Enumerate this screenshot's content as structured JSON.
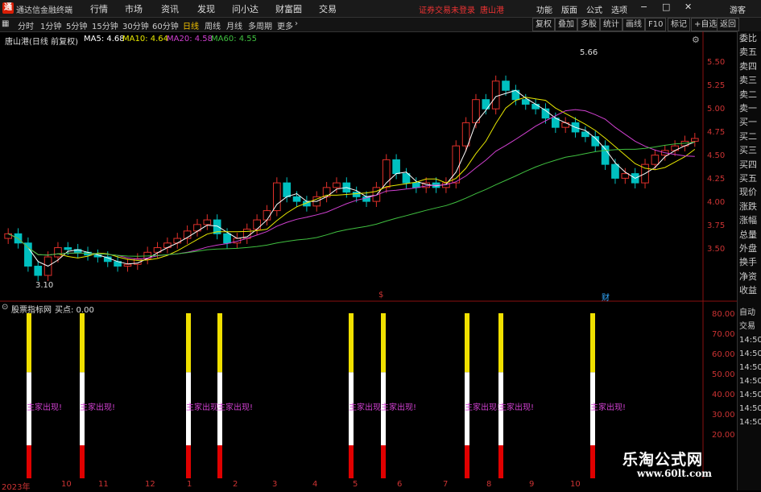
{
  "app": {
    "title": "通达信金融终端",
    "logo": "通"
  },
  "menu": [
    "行情",
    "市场",
    "资讯",
    "发现",
    "问小达",
    "财富圈",
    "交易"
  ],
  "status": {
    "login": "证券交易未登录",
    "stock": "唐山港"
  },
  "menu_right": [
    "功能",
    "版面",
    "公式",
    "选项"
  ],
  "window_buttons": [
    "minimize-icon",
    "maximize-icon",
    "close-icon"
  ],
  "guest": "游客",
  "periods": [
    "分时",
    "1分钟",
    "5分钟",
    "15分钟",
    "30分钟",
    "60分钟",
    "日线",
    "周线",
    "月线",
    "多周期",
    "更多"
  ],
  "period_active": "日线",
  "right_tools": [
    "复权",
    "叠加",
    "多股",
    "统计",
    "画线",
    "F10",
    "标记",
    "+自选",
    "返回"
  ],
  "main_legend": {
    "name": "唐山港(日线 前复权)",
    "ma5": "MA5: 4.68",
    "ma10": "MA10: 4.64",
    "ma20": "MA20: 4.58",
    "ma60": "MA60: 4.55"
  },
  "price_axis": [
    "5.50",
    "5.25",
    "5.00",
    "4.75",
    "4.50",
    "4.25",
    "4.00",
    "3.75",
    "3.50"
  ],
  "annotations": {
    "high": "5.66",
    "low": "3.10"
  },
  "event_marks": [
    "$",
    "财"
  ],
  "indicator": {
    "name": "股票指标网",
    "label": "买点: 0.00",
    "signal_text": "主家出现!"
  },
  "ind_axis": [
    "80.00",
    "70.00",
    "60.00",
    "50.00",
    "40.00",
    "30.00",
    "20.00"
  ],
  "dates": [
    "2023年",
    "10",
    "11",
    "12",
    "1",
    "2",
    "3",
    "4",
    "5",
    "6",
    "7",
    "8",
    "9",
    "10"
  ],
  "side_panel": [
    "委比",
    "卖五",
    "卖四",
    "卖三",
    "卖二",
    "卖一",
    "买一",
    "买二",
    "买三",
    "买四",
    "买五",
    "现价",
    "涨跌",
    "涨幅",
    "总量",
    "外盘",
    "换手",
    "净资",
    "收益"
  ],
  "side_panel_bottom": [
    "自动",
    "交易",
    "14:50",
    "14:50",
    "14:50",
    "14:50",
    "14:50",
    "14:50",
    "14:50"
  ],
  "watermark": {
    "line1": "乐淘公式网",
    "line2": "www.60lt.com"
  },
  "colors": {
    "up": "#e0302a",
    "down": "#00c0c0",
    "ma5": "#ffffff",
    "ma10": "#e8e800",
    "ma20": "#d040d0",
    "ma60": "#40c040",
    "accent": "#f0c000"
  },
  "chart_data": [
    {
      "type": "candlestick",
      "title": "唐山港(日线 前复权)",
      "ylim": [
        3.0,
        5.75
      ],
      "series": [
        {
          "name": "close",
          "values": [
            3.65,
            3.55,
            3.3,
            3.2,
            3.4,
            3.5,
            3.48,
            3.45,
            3.42,
            3.4,
            3.35,
            3.3,
            3.32,
            3.38,
            3.45,
            3.5,
            3.55,
            3.6,
            3.68,
            3.75,
            3.8,
            3.65,
            3.55,
            3.6,
            3.7,
            3.8,
            3.9,
            4.2,
            4.05,
            4.0,
            3.95,
            4.05,
            4.15,
            4.2,
            4.1,
            4.05,
            4.0,
            4.15,
            4.45,
            4.3,
            4.2,
            4.15,
            4.2,
            4.15,
            4.2,
            4.6,
            4.85,
            5.1,
            5.0,
            5.3,
            5.2,
            5.1,
            5.05,
            5.0,
            4.9,
            4.8,
            4.85,
            4.75,
            4.7,
            4.6,
            4.4,
            4.25,
            4.3,
            4.2,
            4.4,
            4.5,
            4.55,
            4.6,
            4.65,
            4.68
          ]
        },
        {
          "name": "MA5",
          "values": [
            4.68
          ]
        },
        {
          "name": "MA10",
          "values": [
            4.64
          ]
        },
        {
          "name": "MA20",
          "values": [
            4.58
          ]
        },
        {
          "name": "MA60",
          "values": [
            4.55
          ]
        }
      ]
    },
    {
      "type": "bar",
      "title": "股票指标网",
      "ylim": [
        15,
        85
      ],
      "signal_positions": [
        36,
        102,
        234,
        273,
        436,
        476,
        580,
        622,
        736
      ],
      "value": 85
    }
  ]
}
